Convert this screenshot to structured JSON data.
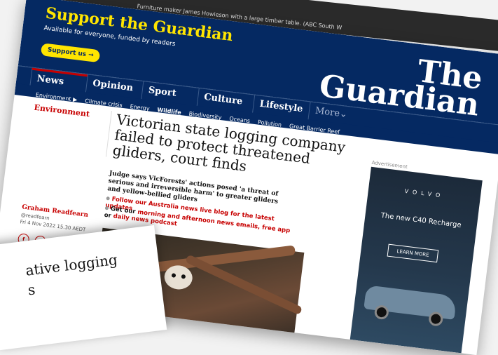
{
  "prev_caption": "Furniture maker James Howieson with a large timber table. (ABC South W",
  "support": {
    "title": "Support the Guardian",
    "subtitle": "Available for everyone, funded by readers",
    "button": "Support us →"
  },
  "logo": {
    "line1": "The",
    "line2": "Guardian"
  },
  "nav": {
    "items": [
      "News",
      "Opinion",
      "Sport",
      "Culture",
      "Lifestyle"
    ],
    "more": "More⌄"
  },
  "subnav": {
    "items": [
      "Environment ▶",
      "Climate crisis",
      "Energy",
      "Wildlife",
      "Biodiversity",
      "Oceans",
      "Pollution",
      "Great Barrier Reef"
    ]
  },
  "article": {
    "section": "Environment",
    "headline": "Victorian state logging company failed to protect threatened gliders, court finds",
    "standfirst": "Judge says VicForests' actions posed 'a threat of serious and irreversible harm' to greater gliders and yellow-bellied gliders",
    "bullet1": "Follow our Australia news live blog for the latest updates",
    "bullet2_plain": "Get our ",
    "bullet2_link": "morning and afternoon news emails, free app",
    "bullet2_or": " or ",
    "bullet2_link2": "daily news podcast"
  },
  "byline": {
    "name": "Graham Readfearn",
    "handle": "@readfearn",
    "date": "Fri 4 Nov 2022 15.30 AEDT"
  },
  "share": [
    "f",
    "t",
    "✉"
  ],
  "ad": {
    "label": "Advertisement",
    "brand": "VOLVO",
    "tagline": "The new C40 Recharge",
    "cta": "LEARN MORE"
  },
  "sheet": {
    "line1": "ative logging",
    "line2": "s"
  },
  "colors": {
    "navy": "#052962",
    "yellow": "#ffe500",
    "red": "#c70000"
  }
}
